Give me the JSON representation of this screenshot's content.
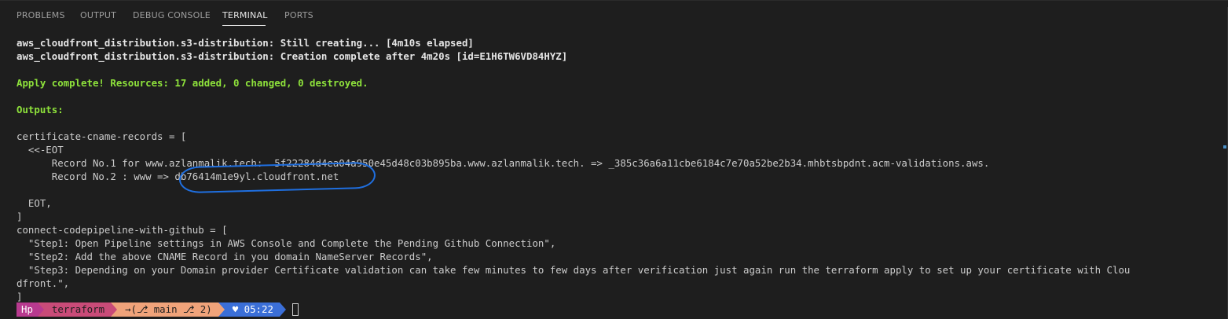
{
  "tabs": [
    {
      "label": "PROBLEMS"
    },
    {
      "label": "OUTPUT"
    },
    {
      "label": "DEBUG CONSOLE"
    },
    {
      "label": "TERMINAL"
    },
    {
      "label": "PORTS"
    }
  ],
  "active_tab": "TERMINAL",
  "terminal": {
    "lines": [
      "aws_cloudfront_distribution.s3-distribution: Still creating... [4m10s elapsed]",
      "aws_cloudfront_distribution.s3-distribution: Creation complete after 4m20s [id=E1H6TW6VD84HYZ]",
      "",
      "Apply complete! Resources: 17 added, 0 changed, 0 destroyed.",
      "",
      "Outputs:",
      "",
      "certificate-cname-records = [",
      "  <<-EOT",
      "      Record No.1 for www.azlanmalik.tech:  5f22284d4ea04a950e45d48c03b895ba.www.azlanmalik.tech. => _385c36a6a11cbe6184c7e70a52be2b34.mhbtsbpdnt.acm-validations.aws.",
      "      Record No.2 : www => ",
      "",
      "  EOT,",
      "]",
      "connect-codepipeline-with-github = [",
      "  \"Step1: Open Pipeline settings in AWS Console and Complete the Pending Github Connection\",",
      "  \"Step2: Add the above CNAME Record in you domain NameServer Records\",",
      "  \"Step3: Depending on your Domain provider Certificate validation can take few minutes to few days after verification just again run the terraform apply to set up your certificate with Clou",
      "dfront.\",",
      "]"
    ],
    "circled_value": "db76414m1e9yl.cloudfront.net"
  },
  "prompt": {
    "user": "Hp",
    "dir": "terraform",
    "git": "→(⎇ main ⎇ 2)",
    "time": "♥ 05:22"
  },
  "colors": {
    "background": "#1e1e1e",
    "success_green": "#8ee23b",
    "annotation_blue": "#1f6fe0"
  }
}
